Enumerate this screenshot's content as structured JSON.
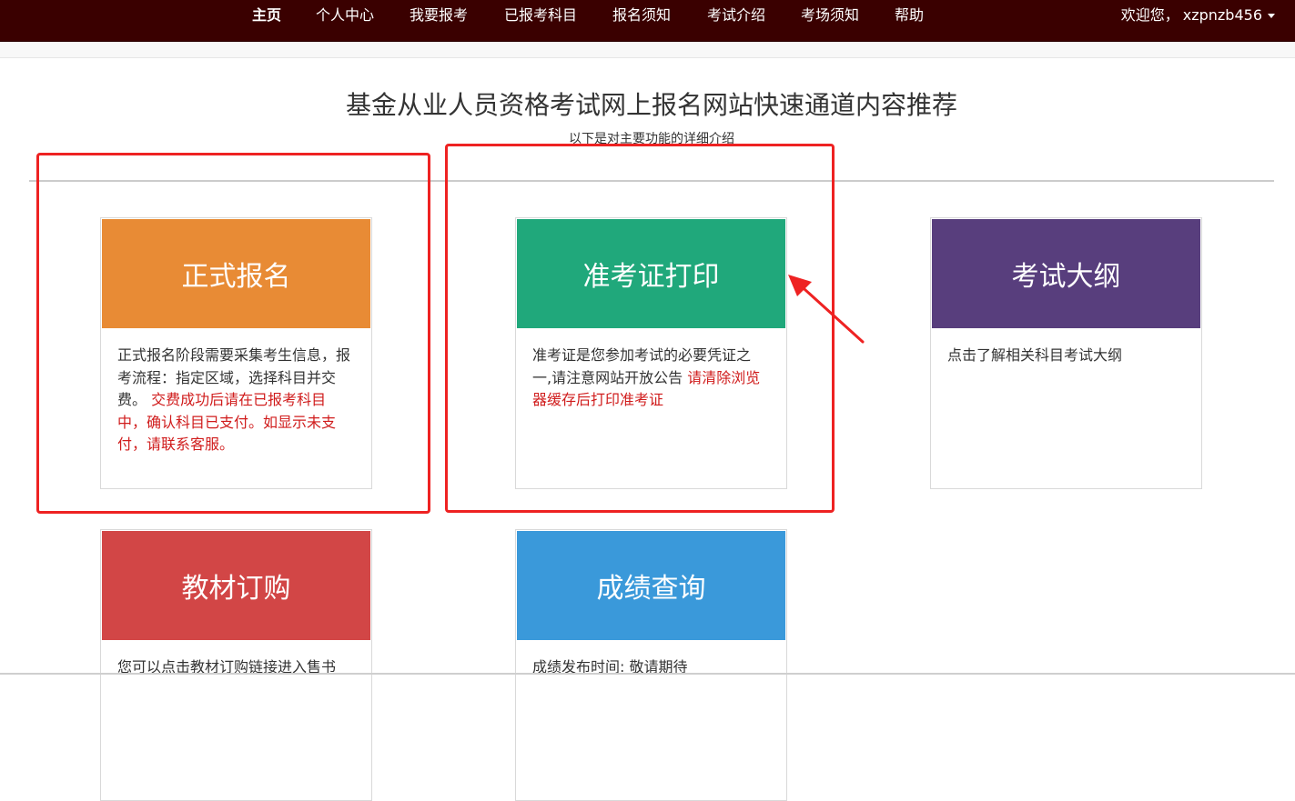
{
  "nav": {
    "items": [
      {
        "label": "主页",
        "active": true
      },
      {
        "label": "个人中心"
      },
      {
        "label": "我要报考"
      },
      {
        "label": "已报考科目"
      },
      {
        "label": "报名须知"
      },
      {
        "label": "考试介绍"
      },
      {
        "label": "考场须知"
      },
      {
        "label": "帮助"
      }
    ],
    "welcome": "欢迎您，",
    "username": "xzpnzb456"
  },
  "header": {
    "title": "基金从业人员资格考试网上报名网站快速通道内容推荐",
    "subtitle": "以下是对主要功能的详细介绍"
  },
  "cards": [
    {
      "title": "正式报名",
      "color": "#e88b35",
      "text": "正式报名阶段需要采集考生信息，报考流程：指定区域，选择科目并交费。",
      "highlight": "交费成功后请在已报考科目中，确认科目已支付。如显示未支付，请联系客服。"
    },
    {
      "title": "准考证打印",
      "color": "#20a87b",
      "text": "准考证是您参加考试的必要凭证之一,请注意网站开放公告",
      "highlight": "请清除浏览器缓存后打印准考证"
    },
    {
      "title": "考试大纲",
      "color": "#583e7d",
      "text": "点击了解相关科目考试大纲",
      "highlight": ""
    },
    {
      "title": "教材订购",
      "color": "#d24646",
      "text": "您可以点击教材订购链接进入售书",
      "highlight": ""
    },
    {
      "title": "成绩查询",
      "color": "#3a99da",
      "text": "成绩发布时间: 敬请期待",
      "highlight": ""
    }
  ],
  "colors": {
    "topbar": "#3a0000",
    "annotation": "#ee2222"
  }
}
